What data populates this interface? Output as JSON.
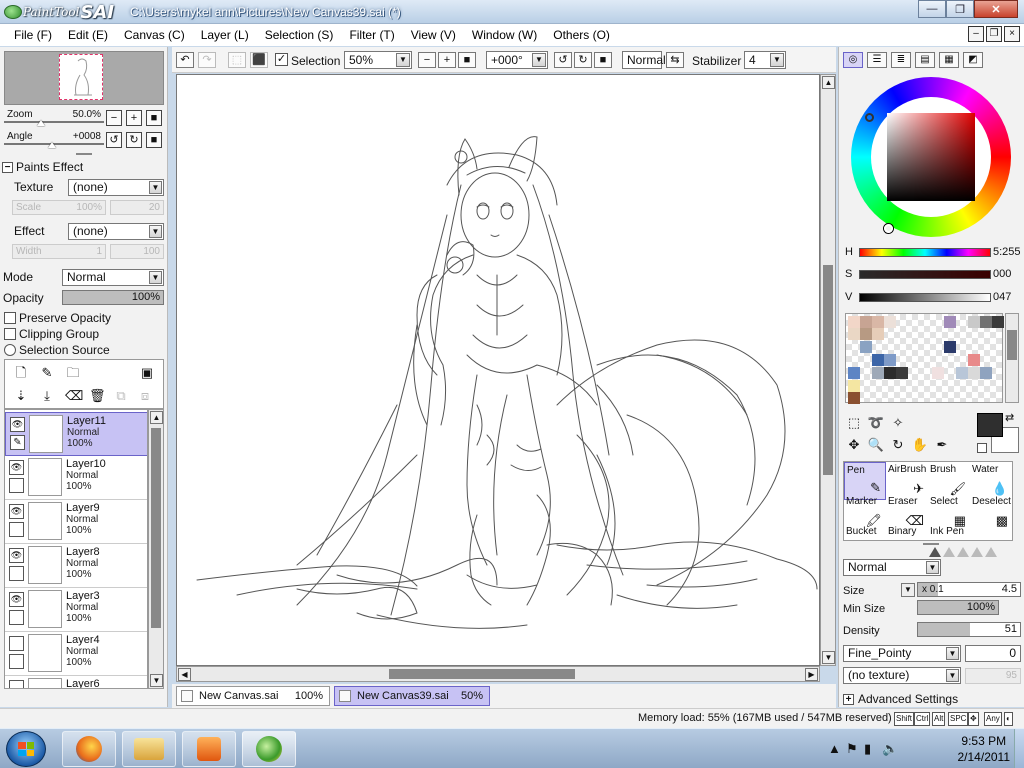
{
  "window": {
    "logo_text": "PaintTool",
    "logo_brand": "SAI",
    "title": "C:\\Users\\mykel ann\\Pictures\\New Canvas39.sai (*)",
    "min_label": "—",
    "max_label": "❐",
    "close_label": "✕"
  },
  "menu": [
    "File (F)",
    "Edit (E)",
    "Canvas (C)",
    "Layer (L)",
    "Selection (S)",
    "Filter (T)",
    "View (V)",
    "Window (W)",
    "Others (O)"
  ],
  "navigator": {
    "zoom_label": "Zoom",
    "zoom_value": "50.0%",
    "angle_label": "Angle",
    "angle_value": "+0008"
  },
  "paints_effect": {
    "header": "Paints Effect",
    "texture_label": "Texture",
    "texture_value": "(none)",
    "scale_label": "Scale",
    "scale_value": "100%",
    "scale_num": "20",
    "effect_label": "Effect",
    "effect_value": "(none)",
    "width_label": "Width",
    "width_value": "1",
    "width_num": "100"
  },
  "layer_props": {
    "mode_label": "Mode",
    "mode_value": "Normal",
    "opacity_label": "Opacity",
    "opacity_value": "100%",
    "opacity_fraction": 1.0,
    "preserve_opacity": "Preserve Opacity",
    "clipping_group": "Clipping Group",
    "selection_source": "Selection Source"
  },
  "layers": [
    {
      "name": "Layer11",
      "mode": "Normal",
      "opacity": "100%",
      "visible": true,
      "selected": true
    },
    {
      "name": "Layer10",
      "mode": "Normal",
      "opacity": "100%",
      "visible": true,
      "selected": false
    },
    {
      "name": "Layer9",
      "mode": "Normal",
      "opacity": "100%",
      "visible": true,
      "selected": false
    },
    {
      "name": "Layer8",
      "mode": "Normal",
      "opacity": "100%",
      "visible": true,
      "selected": false
    },
    {
      "name": "Layer3",
      "mode": "Normal",
      "opacity": "100%",
      "visible": true,
      "selected": false
    },
    {
      "name": "Layer4",
      "mode": "Normal",
      "opacity": "100%",
      "visible": false,
      "selected": false
    },
    {
      "name": "Layer6",
      "mode": "",
      "opacity": "",
      "visible": false,
      "selected": false
    }
  ],
  "toolbar": {
    "selection_label": "Selection",
    "zoom_value": "50%",
    "angle_value": "+000°",
    "blend_value": "Normal",
    "stabilizer_label": "Stabilizer",
    "stabilizer_value": "4"
  },
  "doc_tabs": [
    {
      "name": "New Canvas.sai",
      "zoom": "100%",
      "active": false
    },
    {
      "name": "New Canvas39.sai",
      "zoom": "50%",
      "active": true
    }
  ],
  "color": {
    "h_label": "H",
    "h_value": "5:255",
    "s_label": "S",
    "s_value": "000",
    "v_label": "V",
    "v_value": "047",
    "main_color": "#2f2f2f",
    "sub_color": "#ffffff"
  },
  "swatches": [
    {
      "c": "#f2d6c8"
    },
    {
      "c": "#c7a493"
    },
    {
      "c": "#d9b7a6"
    },
    {
      "c": "#ece0d9"
    },
    {
      "c": "#a08ab8"
    },
    {
      "c": "#c9c9c9"
    },
    {
      "c": "#707070"
    },
    {
      "c": "#3a3a3a"
    },
    {
      "c": "#ead7c5"
    },
    {
      "c": "#b79a83"
    },
    {
      "c": "#e6cdb8"
    },
    {
      "c": "#2b3a6a"
    },
    {
      "c": "#8aa2c2"
    },
    {
      "c": "#3d66a8"
    },
    {
      "c": "#7f9bc8"
    },
    {
      "c": "#e88a8a"
    },
    {
      "c": "#5d84c4"
    },
    {
      "c": "#2c2c2c"
    },
    {
      "c": "#9ea9b8"
    },
    {
      "c": "#3a3a3a"
    },
    {
      "c": "#f0e0e0"
    },
    {
      "c": "#b8c6d8"
    },
    {
      "c": "#d9d9d9"
    },
    {
      "c": "#8fa3bf"
    },
    {
      "c": "#f4e6a2"
    },
    {
      "c": "#8a5030"
    }
  ],
  "brush_tools": [
    {
      "name": "Pen",
      "selected": true
    },
    {
      "name": "AirBrush",
      "selected": false
    },
    {
      "name": "Brush",
      "selected": false
    },
    {
      "name": "Water",
      "selected": false
    },
    {
      "name": "Marker",
      "selected": false
    },
    {
      "name": "Eraser",
      "selected": false
    },
    {
      "name": "Select",
      "selected": false
    },
    {
      "name": "Deselect",
      "selected": false
    },
    {
      "name": "Bucket",
      "selected": false
    },
    {
      "name": "Binary",
      "selected": false
    },
    {
      "name": "Ink Pen",
      "selected": false
    }
  ],
  "brush_settings": {
    "blend_value": "Normal",
    "size_label": "Size",
    "size_mult": "x 0.1",
    "size_value": "4.5",
    "min_size_label": "Min Size",
    "min_size_value": "100%",
    "min_size_fraction": 1.0,
    "density_label": "Density",
    "density_value": "51",
    "density_fraction": 0.51,
    "shape_value": "Fine_Pointy",
    "shape_num": "0",
    "texture_value": "(no texture)",
    "texture_num": "95",
    "advanced_label": "Advanced Settings"
  },
  "status": {
    "memory": "Memory load: 55% (167MB used / 547MB reserved)",
    "keys": [
      "Shift",
      "Ctrl",
      "Alt",
      "SPC",
      "✥",
      "Any",
      "◐"
    ]
  },
  "taskbar": {
    "time": "9:53 PM",
    "date": "2/14/2011"
  }
}
